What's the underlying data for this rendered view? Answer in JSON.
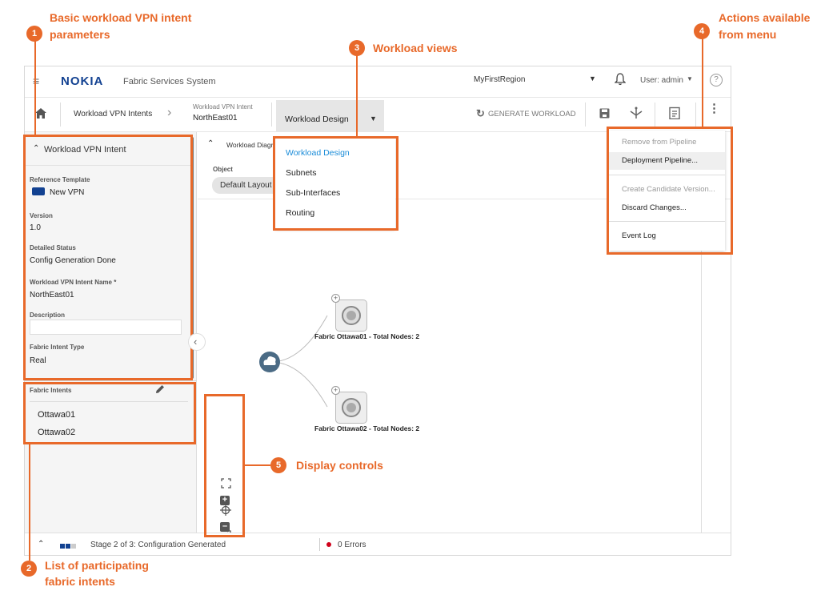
{
  "callouts": {
    "c1": {
      "num": "1",
      "text1": "Basic workload VPN intent",
      "text2": "parameters"
    },
    "c2": {
      "num": "2",
      "text1": "List of participating",
      "text2": "fabric intents"
    },
    "c3": {
      "num": "3",
      "text": "Workload views"
    },
    "c4": {
      "num": "4",
      "text1": "Actions available",
      "text2": "from menu"
    },
    "c5": {
      "num": "5",
      "text": "Display controls"
    }
  },
  "header": {
    "logo": "NOKIA",
    "app_title": "Fabric Services System",
    "region": "MyFirstRegion",
    "user": "User: admin"
  },
  "toolbar": {
    "breadcrumb_root": "Workload VPN Intents",
    "intent_caption": "Workload VPN Intent",
    "intent_name": "NorthEast01",
    "view_selected": "Workload Design",
    "generate_label": "GENERATE WORKLOAD"
  },
  "views_menu": [
    "Workload Design",
    "Subnets",
    "Sub-Interfaces",
    "Routing"
  ],
  "actions_menu": {
    "remove": "Remove from Pipeline",
    "deploy": "Deployment Pipeline...",
    "create": "Create Candidate Version...",
    "discard": "Discard Changes...",
    "event": "Event Log"
  },
  "left_panel": {
    "section_title": "Workload VPN Intent",
    "ref_template_label": "Reference Template",
    "ref_template_value": "New VPN",
    "version_label": "Version",
    "version_value": "1.0",
    "status_label": "Detailed Status",
    "status_value": "Config Generation Done",
    "name_label": "Workload VPN Intent Name *",
    "name_value": "NorthEast01",
    "description_label": "Description",
    "description_value": "",
    "type_label": "Fabric Intent Type",
    "type_value": "Real",
    "fabric_intents_label": "Fabric Intents",
    "fabric_intents": [
      "Ottawa01",
      "Ottawa02"
    ]
  },
  "canvas": {
    "diagram_tab": "Workload Diagr",
    "object_label": "Object",
    "layout_chip": "Default Layout",
    "node1_label": "Fabric Ottawa01 - Total Nodes: 2",
    "node2_label": "Fabric Ottawa02 - Total Nodes: 2"
  },
  "status": {
    "stage": "Stage 2 of 3: Configuration Generated",
    "errors": "0 Errors"
  },
  "colors": {
    "accent": "#e8692a",
    "brand": "#124191",
    "link": "#1a8cd8",
    "error": "#d0021b"
  }
}
